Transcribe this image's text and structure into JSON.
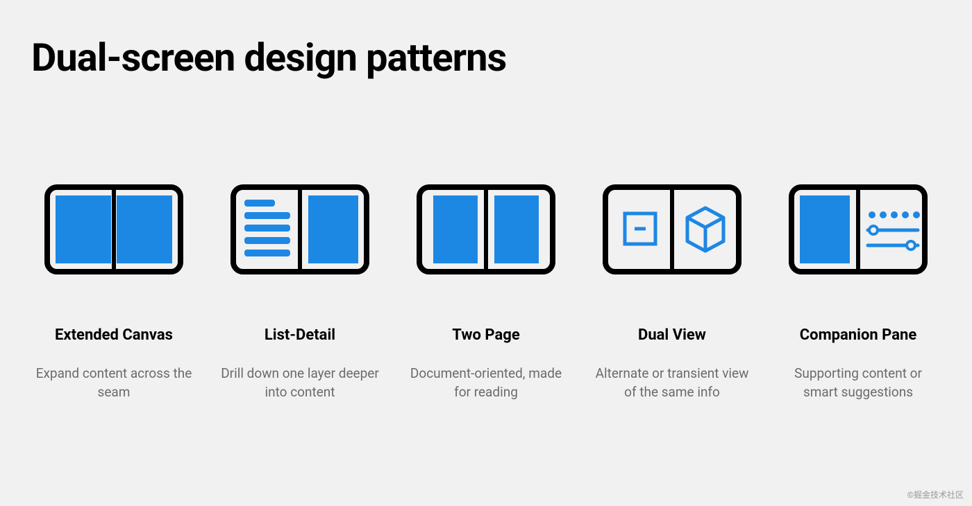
{
  "title": "Dual-screen design patterns",
  "patterns": [
    {
      "name": "Extended Canvas",
      "description": "Expand content across the seam"
    },
    {
      "name": "List-Detail",
      "description": "Drill down one layer deeper into content"
    },
    {
      "name": "Two Page",
      "description": "Document-oriented, made for reading"
    },
    {
      "name": "Dual View",
      "description": "Alternate or transient view of the same info"
    },
    {
      "name": "Companion Pane",
      "description": "Supporting content or smart suggestions"
    }
  ],
  "watermark": "©掘金技术社区",
  "colors": {
    "blue": "#1d87e4",
    "black": "#000000"
  }
}
